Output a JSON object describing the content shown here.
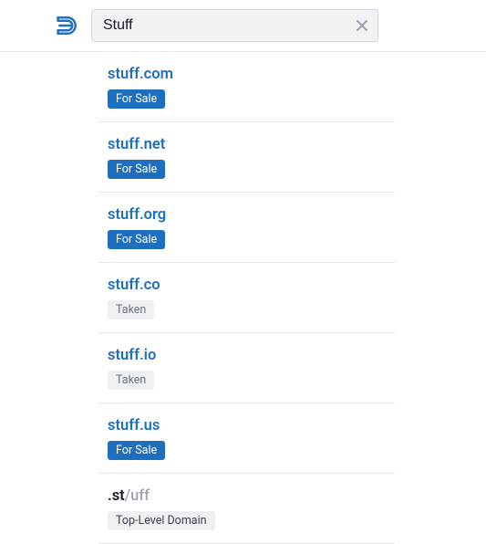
{
  "search": {
    "value": "Stuff",
    "placeholder": ""
  },
  "badges": {
    "forsale": "For Sale",
    "taken": "Taken",
    "tld": "Top-Level Domain"
  },
  "results": [
    {
      "name": "stuff.com",
      "status": "forsale"
    },
    {
      "name": "stuff.net",
      "status": "forsale"
    },
    {
      "name": "stuff.org",
      "status": "forsale"
    },
    {
      "name": "stuff.co",
      "status": "taken"
    },
    {
      "name": "stuff.io",
      "status": "taken"
    },
    {
      "name": "stuff.us",
      "status": "forsale"
    },
    {
      "prefix": ".st",
      "suffix": "/uff",
      "status": "tld"
    }
  ],
  "colors": {
    "accent": "#1e6fbf"
  }
}
